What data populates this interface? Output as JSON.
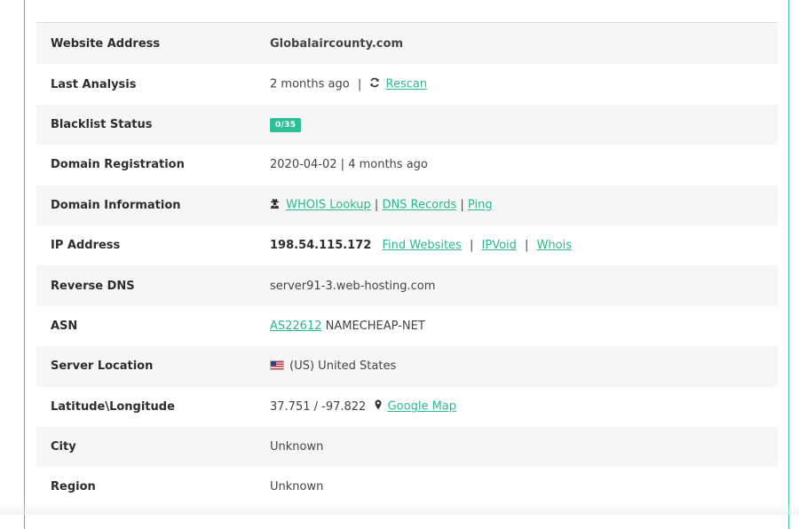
{
  "rows": {
    "website_address": {
      "label": "Website Address",
      "value": "Globalaircounty.com"
    },
    "last_analysis": {
      "label": "Last Analysis",
      "value": "2 months ago",
      "separator": "|",
      "rescan_label": "Rescan"
    },
    "blacklist_status": {
      "label": "Blacklist Status",
      "badge": "0/35"
    },
    "domain_registration": {
      "label": "Domain Registration",
      "value": "2020-04-02 | 4 months ago"
    },
    "domain_information": {
      "label": "Domain Information",
      "whois_lookup": "WHOIS Lookup",
      "dns_records": "DNS Records",
      "ping": "Ping",
      "separator": "|"
    },
    "ip_address": {
      "label": "IP Address",
      "ip": "198.54.115.172",
      "find_websites": "Find Websites",
      "ipvoid": "IPVoid",
      "whois": "Whois",
      "separator": "|"
    },
    "reverse_dns": {
      "label": "Reverse DNS",
      "value": "server91-3.web-hosting.com"
    },
    "asn": {
      "label": "ASN",
      "asn_link": "AS22612",
      "asn_name": "NAMECHEAP-NET"
    },
    "server_location": {
      "label": "Server Location",
      "value": "(US) United States"
    },
    "lat_long": {
      "label": "Latitude\\Longitude",
      "value": "37.751 / -97.822",
      "map_link": "Google Map"
    },
    "city": {
      "label": "City",
      "value": "Unknown"
    },
    "region": {
      "label": "Region",
      "value": "Unknown"
    }
  },
  "colors": {
    "accent": "#2bb88f",
    "badge_bg": "#2fbf96",
    "row_stripe": "#f6f6f6",
    "panel_border": "#3cc29a"
  },
  "icons": {
    "rescan": "refresh-icon",
    "domain_information": "user-secret-icon",
    "server_location": "us-flag-icon",
    "map": "map-marker-icon"
  }
}
